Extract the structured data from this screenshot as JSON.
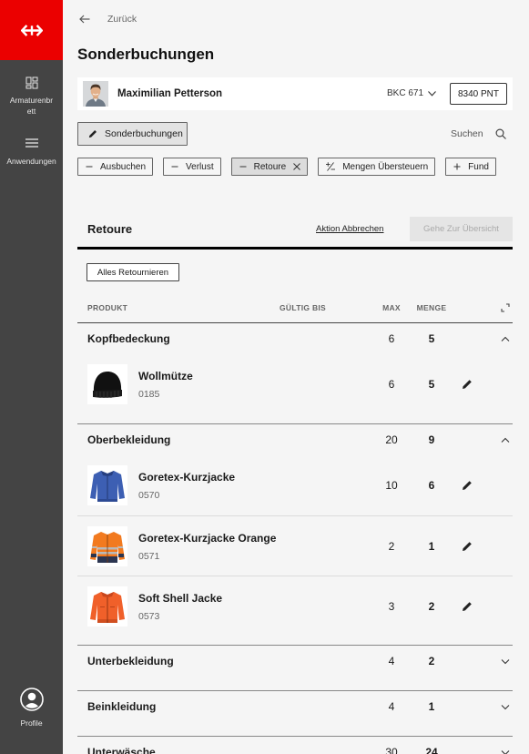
{
  "theme": {
    "brand_red": "#eb0000",
    "sidebar_bg": "#444444",
    "page_bg": "#f5f5f5"
  },
  "brand": {
    "logo_icon": "sbb-logo-icon"
  },
  "sidebar": {
    "items": [
      {
        "label": "Armaturenbrett",
        "icon": "dashboard-icon"
      },
      {
        "label": "Anwendungen",
        "icon": "hamburger-menu-icon"
      }
    ],
    "profile": {
      "label": "Profile",
      "icon": "profile-icon"
    }
  },
  "nav": {
    "back_label": "Zurück",
    "back_icon": "arrow-left-icon"
  },
  "page": {
    "title": "Sonderbuchungen"
  },
  "user": {
    "name": "Maximilian Petterson",
    "cost_center": "BKC 671",
    "points_button": "8340 PNT"
  },
  "toolbar": {
    "mode_button": "Sonderbuchungen",
    "mode_icon": "pencil-icon",
    "search_label": "Suchen",
    "search_icon": "search-icon"
  },
  "actions": [
    {
      "label": "Ausbuchen",
      "icon": "minus-icon",
      "selected": false
    },
    {
      "label": "Verlust",
      "icon": "minus-icon",
      "selected": false
    },
    {
      "label": "Retoure",
      "icon": "minus-icon",
      "selected": true,
      "close_icon": "close-icon"
    },
    {
      "label": "Mengen Übersteuern",
      "icon": "plus-minus-icon",
      "selected": false
    },
    {
      "label": "Fund",
      "icon": "plus-icon",
      "selected": false
    }
  ],
  "section": {
    "title": "Retoure",
    "cancel_label": "Aktion Abbrechen",
    "overview_button": "Gehe Zur Übersicht",
    "overview_disabled": true,
    "return_all_button": "Alles Retournieren"
  },
  "table": {
    "columns": {
      "product": "PRODUKT",
      "valid_until": "GÜLTIG BIS",
      "max": "MAX",
      "quantity": "MENGE"
    },
    "groups": [
      {
        "name": "Kopfbedeckung",
        "max": 6,
        "quantity": 5,
        "expanded": true,
        "items": [
          {
            "name": "Wollmütze",
            "code": "0185",
            "max": 6,
            "quantity": 5,
            "image_icon": "beanie-image"
          }
        ]
      },
      {
        "name": "Oberbekleidung",
        "max": 20,
        "quantity": 9,
        "expanded": true,
        "items": [
          {
            "name": "Goretex-Kurzjacke",
            "code": "0570",
            "max": 10,
            "quantity": 6,
            "image_icon": "blue-jacket-image"
          },
          {
            "name": "Goretex-Kurzjacke Orange",
            "code": "0571",
            "max": 2,
            "quantity": 1,
            "image_icon": "orange-hi-vis-jacket-image"
          },
          {
            "name": "Soft Shell Jacke",
            "code": "0573",
            "max": 3,
            "quantity": 2,
            "image_icon": "orange-softshell-jacket-image"
          }
        ]
      },
      {
        "name": "Unterbekleidung",
        "max": 4,
        "quantity": 2,
        "expanded": false,
        "items": []
      },
      {
        "name": "Beinkleidung",
        "max": 4,
        "quantity": 1,
        "expanded": false,
        "items": []
      },
      {
        "name": "Unterwäsche",
        "max": 30,
        "quantity": 24,
        "expanded": false,
        "items": []
      }
    ]
  }
}
